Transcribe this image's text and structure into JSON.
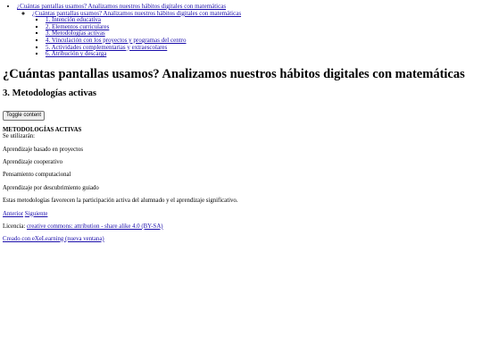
{
  "nav": {
    "root_label": "¿Cuántas pantallas usamos? Analizamos nuestros hábitos digitales con matemáticas",
    "child_label": "¿Cuántas pantallas usamos? Analizamos nuestros hábitos digitales con matemáticas",
    "items": [
      "1. Intención educativa",
      "2. Elementos curriculares",
      "3. Metodologías activas",
      "4. Vinculación con los proyectos y programas del centro",
      "5. Actividades complementarias y extraescolares",
      "6. Atribución y descarga"
    ]
  },
  "header": {
    "title": "¿Cuántas pantallas usamos? Analizamos nuestros hábitos digitales con matemáticas",
    "subtitle": "3. Metodologías activas"
  },
  "toggle_label": "Toggle content",
  "idevice": {
    "title": "METODOLOGÍAS ACTIVAS",
    "intro": "Se utilizarán:",
    "methods": [
      "Aprendizaje basado en proyectos",
      "Aprendizaje cooperativo",
      "Pensamiento computacional",
      "Aprendizaje por descubrimiento guiado"
    ],
    "closing": "Estas metodologías favorecen la participación activa del alumnado y el aprendizaje significativo."
  },
  "pagination": {
    "prev_label": "Anterior",
    "next_label": "Siguiente"
  },
  "license": {
    "prefix": "Licencia: ",
    "link_label": "creative commons: attribution - share alike 4.0 (BY-SA)"
  },
  "footer": {
    "made_with": "Creado con eXeLearning (nueva ventana)"
  }
}
